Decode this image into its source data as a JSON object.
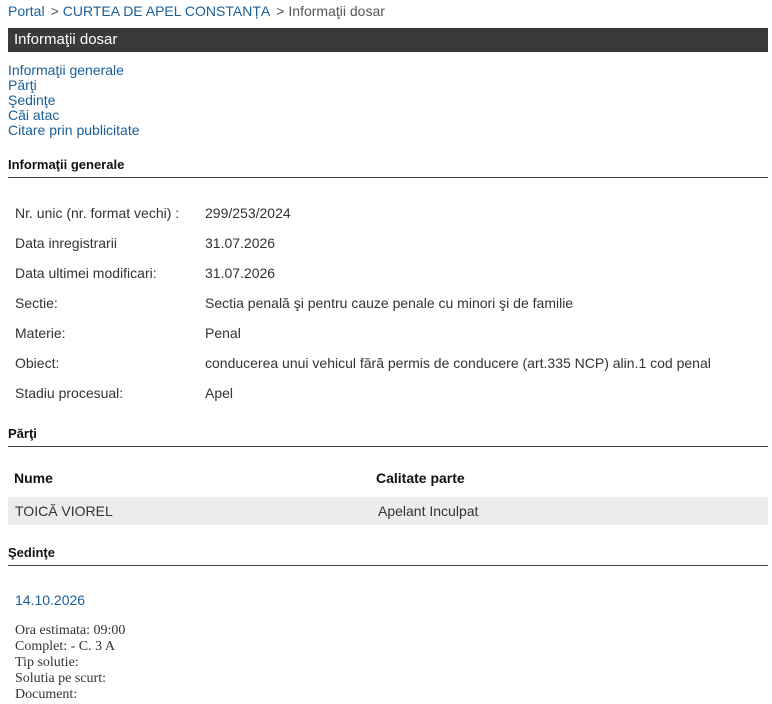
{
  "breadcrumb": {
    "portal": "Portal",
    "court": "CURTEA DE APEL CONSTANȚA",
    "current": "Informaţii dosar",
    "separator": ">"
  },
  "title_bar": "Informaţii dosar",
  "toc": [
    "Informaţii generale",
    "Părţi",
    "Şedinţe",
    "Căi atac",
    "Citare prin publicitate"
  ],
  "sections": {
    "general": "Informaţii generale",
    "parti": "Părţi",
    "sedinte": "Şedinţe"
  },
  "general_info": [
    {
      "label": "Nr. unic (nr. format vechi) :",
      "value": "299/253/2024"
    },
    {
      "label": "Data inregistrarii",
      "value": "31.07.2026"
    },
    {
      "label": "Data ultimei modificari:",
      "value": "31.07.2026"
    },
    {
      "label": "Sectie:",
      "value": "Sectia penală şi pentru cauze penale cu minori şi de familie"
    },
    {
      "label": "Materie:",
      "value": "Penal"
    },
    {
      "label": "Obiect:",
      "value": "conducerea unui vehicul fără permis de conducere (art.335 NCP) alin.1 cod penal"
    },
    {
      "label": "Stadiu procesual:",
      "value": "Apel"
    }
  ],
  "parti_table": {
    "headers": [
      "Nume",
      "Calitate parte"
    ],
    "rows": [
      {
        "nume": "TOICĂ VIOREL",
        "calitate": "Apelant Inculpat"
      }
    ]
  },
  "sedinta": {
    "date": "14.10.2026",
    "details": [
      "Ora estimata: 09:00",
      "Complet: - C. 3 A",
      "Tip solutie:",
      "Solutia pe scurt:",
      "Document:"
    ]
  }
}
